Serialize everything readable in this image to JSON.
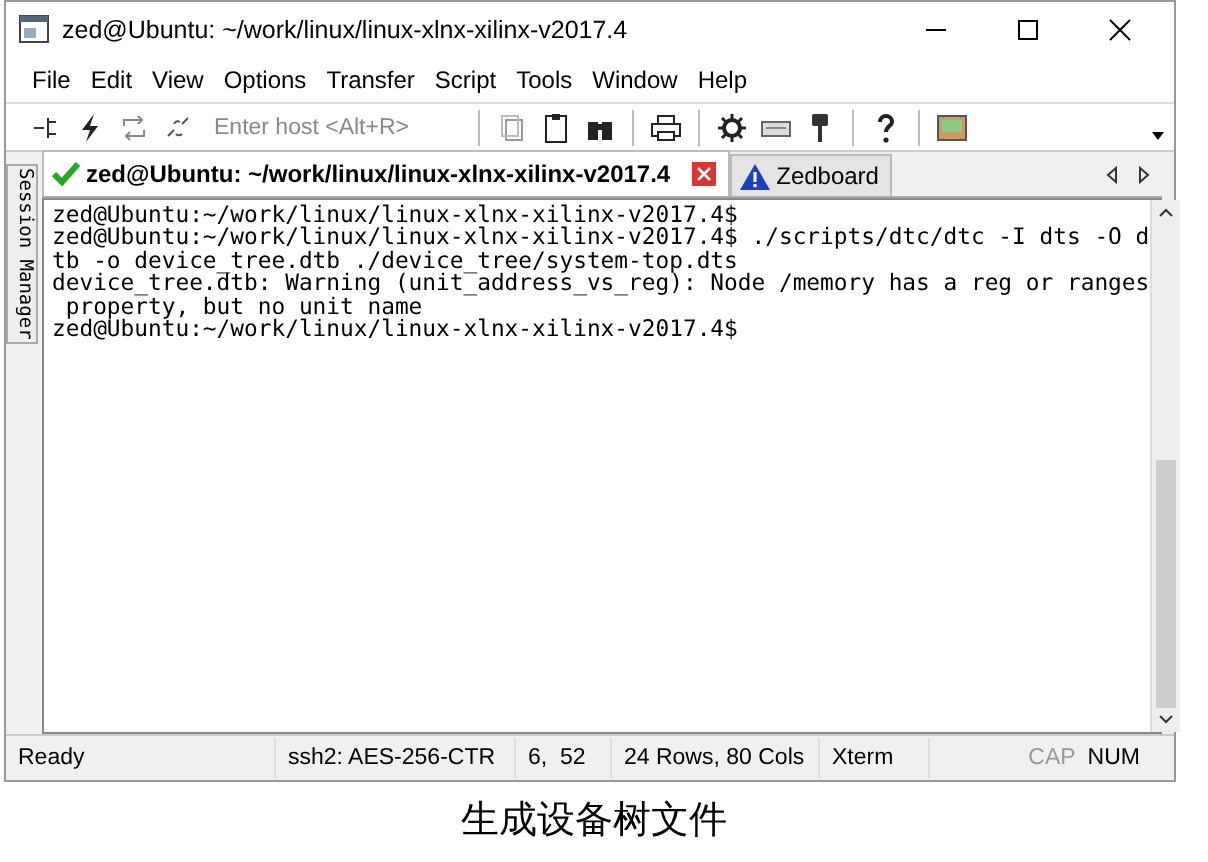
{
  "window": {
    "title": "zed@Ubuntu: ~/work/linux/linux-xlnx-xilinx-v2017.4"
  },
  "menu": [
    "File",
    "Edit",
    "View",
    "Options",
    "Transfer",
    "Script",
    "Tools",
    "Window",
    "Help"
  ],
  "toolbar": {
    "host_field": {
      "placeholder": "Enter host <Alt+R>"
    }
  },
  "session_manager": {
    "label": "Session Manager"
  },
  "tabs": [
    {
      "label": "zed@Ubuntu: ~/work/linux/linux-xlnx-xilinx-v2017.4",
      "selected": true,
      "kind": "connected"
    },
    {
      "label": "Zedboard",
      "selected": false,
      "kind": "warning"
    }
  ],
  "terminal": {
    "lines": [
      "zed@Ubuntu:~/work/linux/linux-xlnx-xilinx-v2017.4$",
      "zed@Ubuntu:~/work/linux/linux-xlnx-xilinx-v2017.4$ ./scripts/dtc/dtc -I dts -O d",
      "tb -o device_tree.dtb ./device_tree/system-top.dts",
      "device_tree.dtb: Warning (unit_address_vs_reg): Node /memory has a reg or ranges",
      " property, but no unit name",
      "zed@Ubuntu:~/work/linux/linux-xlnx-xilinx-v2017.4$"
    ]
  },
  "status_bar": {
    "fields": [
      "Ready",
      "ssh2: AES-256-CTR",
      "6,  52",
      "24 Rows, 80 Cols",
      "Xterm"
    ],
    "indicators": [
      {
        "label": "CAP",
        "on": false
      },
      {
        "label": "NUM",
        "on": true
      }
    ]
  },
  "caption": "生成设备树文件"
}
